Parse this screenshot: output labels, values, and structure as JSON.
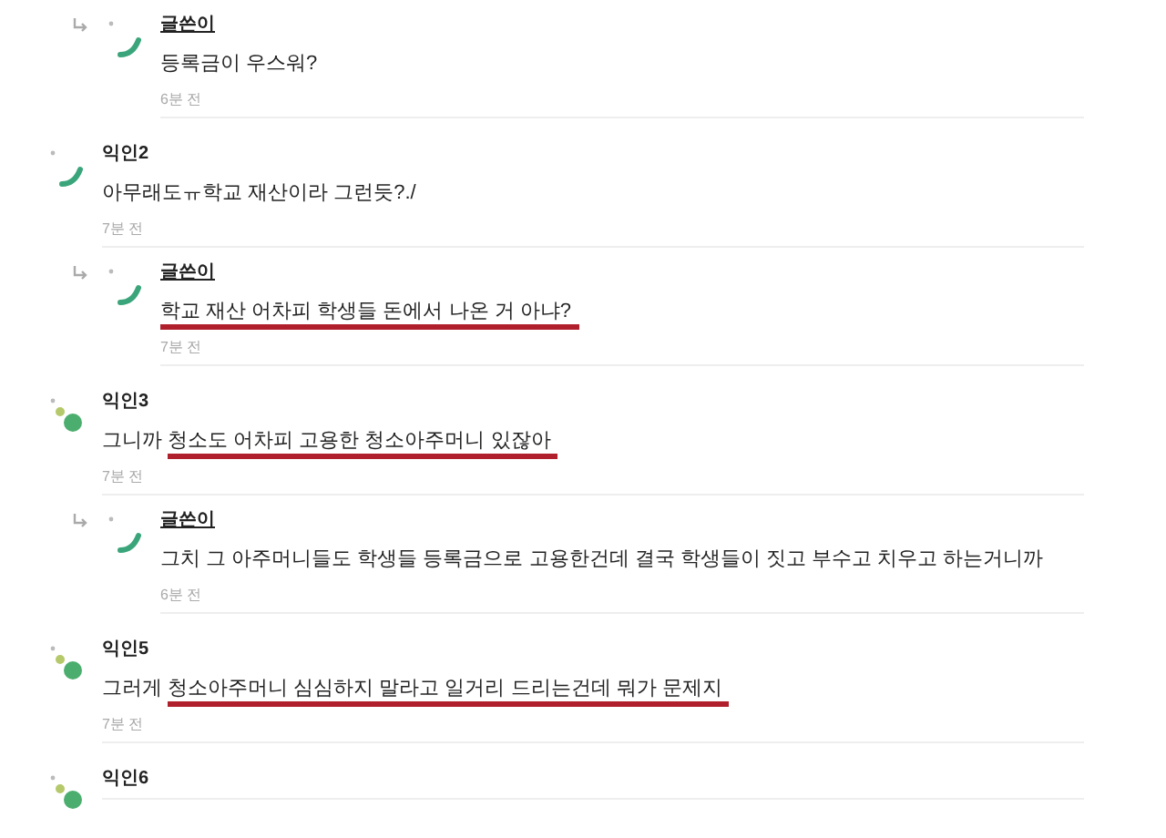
{
  "comments": [
    {
      "reply": true,
      "author": "글쓴이",
      "op": true,
      "kind": "arc",
      "parts": [
        {
          "text": "등록금이 우스워?",
          "marked": false
        }
      ],
      "time": "6분 전"
    },
    {
      "reply": false,
      "author": "익인2",
      "op": false,
      "kind": "arc",
      "parts": [
        {
          "text": "아무래도ㅠ학교 재산이라 그런듯?./",
          "marked": false
        }
      ],
      "time": "7분 전"
    },
    {
      "reply": true,
      "author": "글쓴이",
      "op": true,
      "kind": "arc",
      "parts": [
        {
          "text": "학교 재산 어차피 학생들 돈에서 나온 거 아냐?",
          "marked": true
        }
      ],
      "time": "7분 전"
    },
    {
      "reply": false,
      "author": "익인3",
      "op": false,
      "kind": "dots",
      "parts": [
        {
          "text": "그니까 ",
          "marked": false
        },
        {
          "text": "청소도 어차피 고용한 청소아주머니 있잖아",
          "marked": true
        }
      ],
      "time": "7분 전"
    },
    {
      "reply": true,
      "author": "글쓴이",
      "op": true,
      "kind": "arc",
      "parts": [
        {
          "text": "그치 그 아주머니들도 학생들 등록금으로 고용한건데 결국 학생들이 짓고 부수고 치우고 하는거니까",
          "marked": false
        }
      ],
      "time": "6분 전"
    },
    {
      "reply": false,
      "author": "익인5",
      "op": false,
      "kind": "dots",
      "parts": [
        {
          "text": "그러게 ",
          "marked": false
        },
        {
          "text": "청소아주머니 심심하지 말라고 일거리 드리는건데 뭐가 문제지",
          "marked": true
        }
      ],
      "time": "7분 전"
    },
    {
      "reply": false,
      "author": "익인6",
      "op": false,
      "kind": "dots"
    }
  ]
}
